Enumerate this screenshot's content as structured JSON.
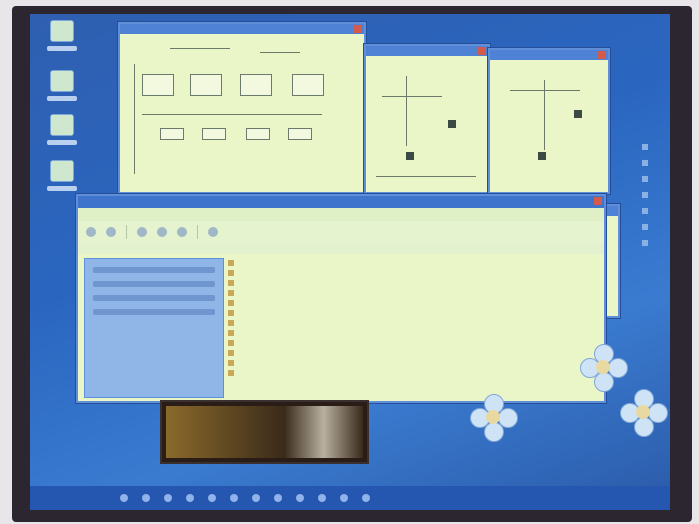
{
  "colors": {
    "desktop": "#2a66c0",
    "window_bg": "#eaf6c8",
    "titlebar": "#4f82d4",
    "taskbar": "#2557b0",
    "bezel": "#2b2630"
  },
  "desktop_icons": [
    "computer-icon",
    "documents-icon",
    "network-icon",
    "recycle-bin-icon"
  ],
  "explorer": {
    "menu": [
      "",
      "",
      "",
      "",
      "",
      ""
    ],
    "files": [
      {
        "name": "",
        "size": "",
        "type": "",
        "date": ""
      },
      {
        "name": "",
        "size": "",
        "type": "",
        "date": ""
      },
      {
        "name": "",
        "size": "",
        "type": "",
        "date": ""
      },
      {
        "name": "",
        "size": "",
        "type": "",
        "date": ""
      },
      {
        "name": "",
        "size": "",
        "type": "",
        "date": ""
      },
      {
        "name": "",
        "size": "",
        "type": "",
        "date": ""
      },
      {
        "name": "",
        "size": "",
        "type": "",
        "date": ""
      },
      {
        "name": "",
        "size": "",
        "type": "",
        "date": ""
      },
      {
        "name": "",
        "size": "",
        "type": "",
        "date": ""
      },
      {
        "name": "",
        "size": "",
        "type": "",
        "date": ""
      },
      {
        "name": "",
        "size": "",
        "type": "",
        "date": ""
      },
      {
        "name": "",
        "size": "",
        "type": "",
        "date": ""
      }
    ]
  }
}
